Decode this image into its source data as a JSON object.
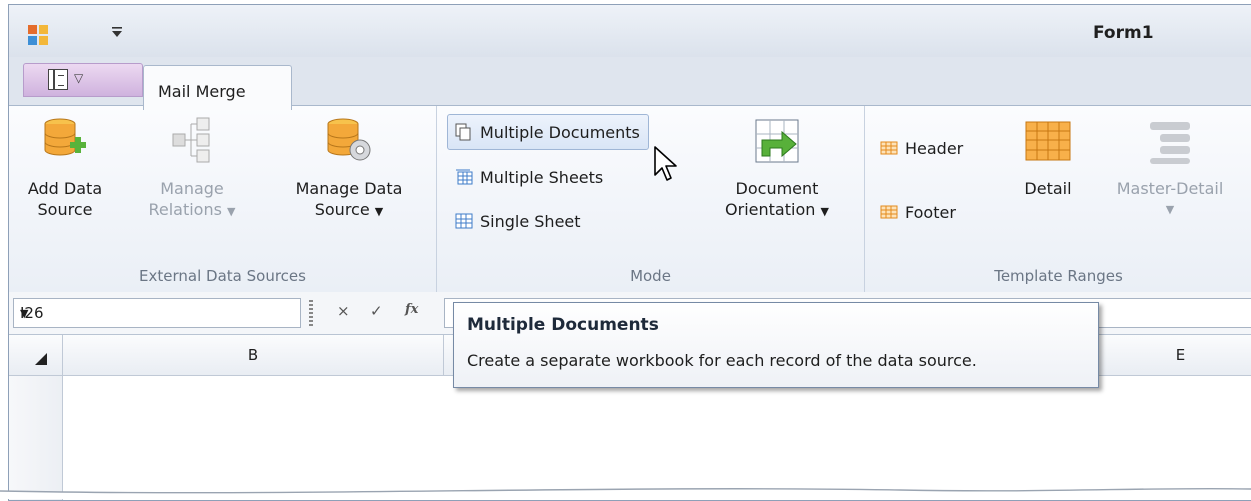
{
  "window": {
    "title": "Form1"
  },
  "qat": {
    "customize_icon": "dropdown-arrow-icon"
  },
  "tabs": {
    "active_label": "Mail Merge"
  },
  "ribbon": {
    "external": {
      "label": "External Data Sources",
      "add_line1": "Add Data",
      "add_line2": "Source",
      "relations_line1": "Manage",
      "relations_line2": "Relations",
      "manage_line1": "Manage Data",
      "manage_line2": "Source"
    },
    "mode": {
      "label": "Mode",
      "multiple_documents": "Multiple Documents",
      "multiple_sheets": "Multiple Sheets",
      "single_sheet": "Single Sheet",
      "orientation_line1": "Document",
      "orientation_line2": "Orientation"
    },
    "template": {
      "label": "Template Ranges",
      "header": "Header",
      "footer": "Footer",
      "detail": "Detail",
      "master_detail": "Master-Detail"
    }
  },
  "formula_bar": {
    "cell_ref": "I26",
    "cancel": "×",
    "enter": "✓",
    "fx": "fx"
  },
  "sheet": {
    "columns": [
      "B",
      "E"
    ]
  },
  "tooltip": {
    "title": "Multiple Documents",
    "body": "Create a separate workbook for each record of the data source."
  },
  "colors": {
    "ribbon_bg": "#eaeff6",
    "frame": "#dfe5ee",
    "accent_orange": "#f29a2e",
    "green_arrow": "#58b03a"
  }
}
